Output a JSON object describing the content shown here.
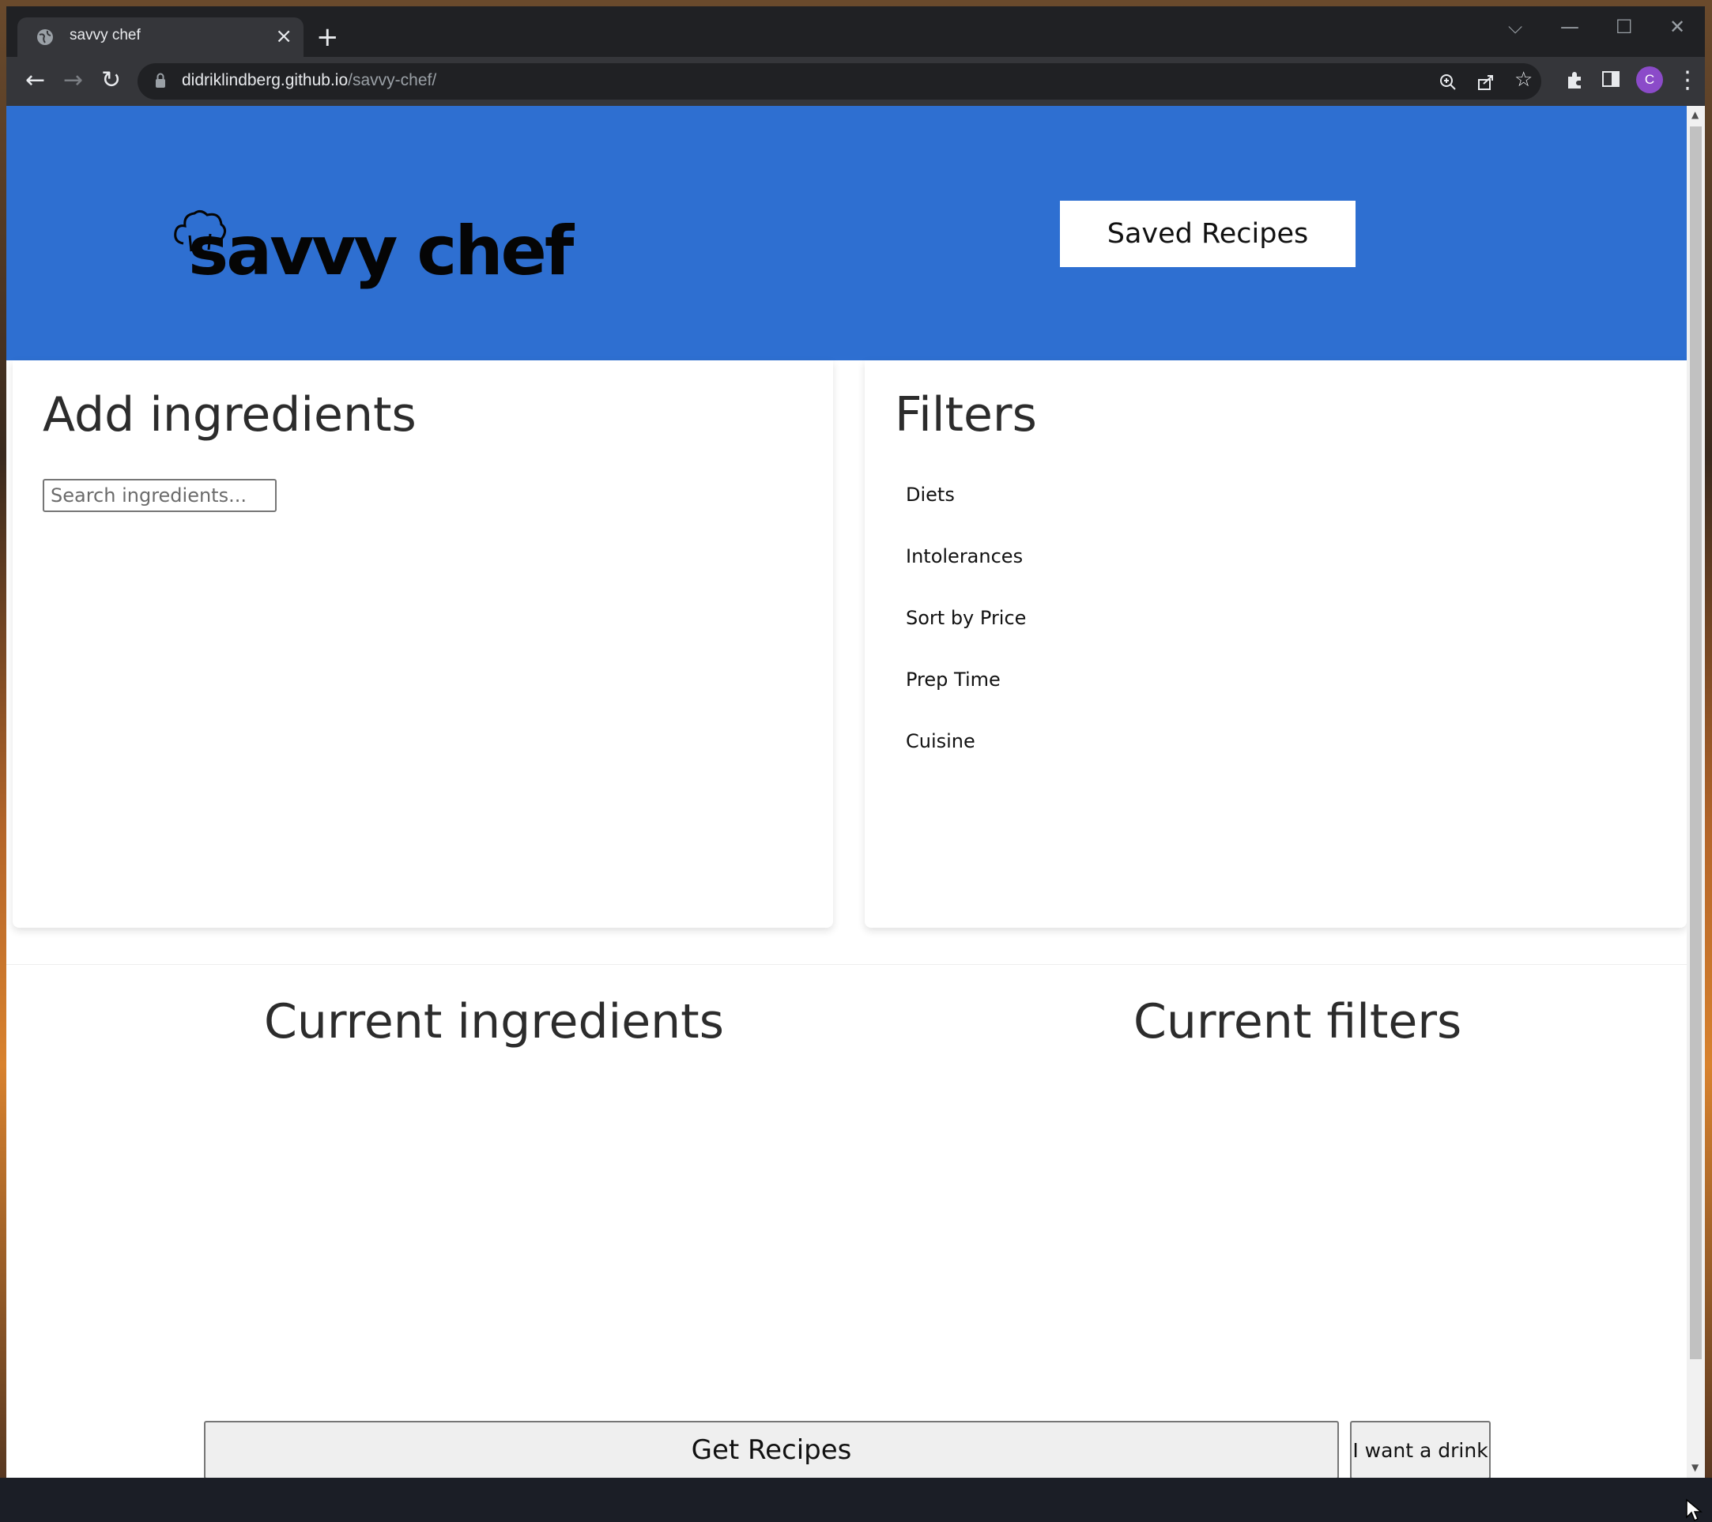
{
  "browser": {
    "tab_title": "savvy chef",
    "url_host": "didriklindberg.github.io",
    "url_path": "/savvy-chef/",
    "profile_initial": "C"
  },
  "header": {
    "logo_text": "savvy chef",
    "saved_recipes_label": "Saved Recipes",
    "background_color": "#2e6fd1"
  },
  "add_ingredients": {
    "title": "Add ingredients",
    "search_placeholder": "Search ingredients..."
  },
  "filters": {
    "title": "Filters",
    "items": [
      "Diets",
      "Intolerances",
      "Sort by Price",
      "Prep Time",
      "Cuisine"
    ]
  },
  "current": {
    "ingredients_title": "Current ingredients",
    "filters_title": "Current filters"
  },
  "actions": {
    "get_recipes_label": "Get Recipes",
    "drink_label": "I want a drink"
  }
}
